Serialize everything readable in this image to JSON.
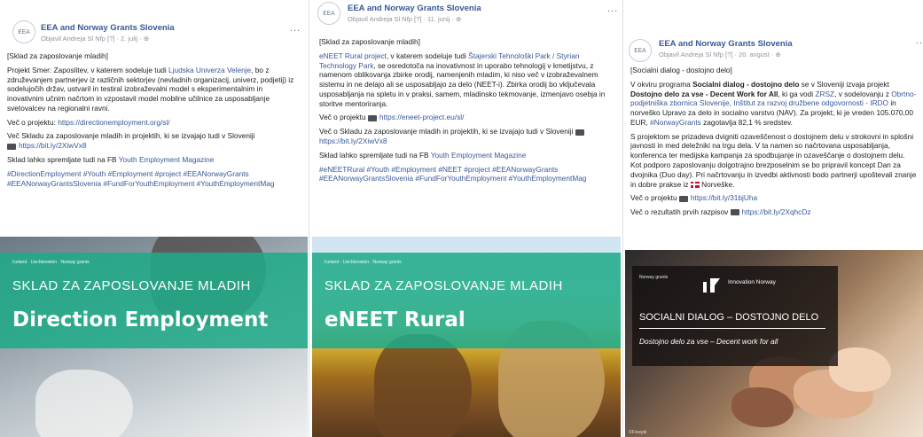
{
  "posts": [
    {
      "page_name": "EEA and Norway Grants Slovenia",
      "meta": "Objavil Andreja Sl Nfp [?] · 2. julij · ",
      "more": "...",
      "paragraphs": {
        "title": "[Sklad za zaposlovanje mladih]",
        "p1_a": "Projekt Smer: Zaposlitev, v katerem sodeluje tudi ",
        "p1_link": "Ljudska Univerza Velenje",
        "p1_b": ", bo z združevanjem partnerjev iz različnih sektorjev (nevladnih organizacij, univerz, podjetij) iz sodelujočih držav, ustvaril in testiral izobraževalni model s eksperimentalnim in inovativnim učnim načrtom in vzpostavil model mobilne učilnice za usposabljanje svetovalcev na regionalni ravni.",
        "p2_a": "Več o projektu: ",
        "p2_link": "https://directionemployment.org/sl/",
        "p3": "Več Skladu za zaposlovanje mladih in projektih, ki se izvajajo tudi v Sloveniji",
        "p3_link": "https://bit.ly/2XiwVx8",
        "p4_a": "Sklad lahko spremljate tudi na FB ",
        "p4_link": "Youth Employment Magazine",
        "tags": "#DirectionEmployment #Youth #Employment #project #EEANorwayGrants #EEANorwayGrantsSlovenia #FundForYouthEmployment #YouthEmploymentMag"
      },
      "image": {
        "logo_text": "Iceland · Liechtenstein · Norway grants",
        "band_title": "SKLAD ZA ZAPOSLOVANJE MLADIH",
        "project_name": "Direction Employment"
      }
    },
    {
      "page_name": "EEA and Norway Grants Slovenia",
      "meta": "Objavil Andreja Sl Nfp [?] · 11. junij · ",
      "more": "...",
      "paragraphs": {
        "title": "[Sklad za zaposlovanje mladih]",
        "p1_link_a": "eNEET Rural project",
        "p1_a": ", v katerem sodeluje tudi ",
        "p1_link_b": "Štajerski Tehnološki Park / Styrian Technology Park",
        "p1_b": ", se osredotoča na inovativnost in uporabo tehnologij v kmetijstvu, z namenom oblikovanja zbirke orodij, namenjenih mladim, ki niso več v izobraževalnem sistemu in ne delajo ali se usposabljajo za delo (NEET-i). Zbirka orodij bo vključevala usposabljanja na spletu in v praksi, samem, mladinsko tekmovanje, izmenjavo osebja in storitve mentoriranja.",
        "p2_a": "Več o projektu",
        "p2_link": "https://eneet-project.eu/sl/",
        "p3": "Več o Skladu za zaposlovanje mladih in projektih, ki se izvajajo tudi v Sloveniji",
        "p3_link": "https://bit.ly/2XiwVx8",
        "p4_a": "Sklad lahko spremljate tudi na FB ",
        "p4_link": "Youth Employment Magazine",
        "tags": "#eNEETRural #Youth #Employment #NEET #project #EEANorwayGrants #EEANorwayGrantsSlovenia #FundForYouthEmployment #YouthEmploymentMag"
      },
      "image": {
        "logo_text": "Iceland · Liechtenstein · Norway grants",
        "band_title": "SKLAD ZA ZAPOSLOVANJE MLADIH",
        "project_name": "eNEET Rural"
      }
    },
    {
      "page_name": "EEA and Norway Grants Slovenia",
      "meta": "Objavil Andreja Sl Nfp [?] · 20. avgust · ",
      "more": "...",
      "paragraphs": {
        "title": "[Socialni dialog - dostojno delo]",
        "p1_a": "V okviru programa ",
        "p1_bold": "Socialni dialog - dostojno delo",
        "p1_b": " se v Sloveniji izvaja projekt ",
        "p1_bold2": "Dostojno delo za vse - Decent Work for All",
        "p1_c": ", ki ga vodi ",
        "p1_link": "ZRSZ",
        "p1_d": ", v sodelovanju z ",
        "p1_link2": "Obrtno-podjetniška zbornica Slovenije, Inštitut za razvoj družbene odgovornosti - IRDO",
        "p1_e": " in norveško Upravo za delo in socialno varstvo (NAV). Za projekt, ki je vreden 105.070,00 EUR, ",
        "p1_tag": "#NorwayGrants",
        "p1_f": " zagotavlja 82,1 % sredstev.",
        "p2": "S projektom se prizadeva dvigniti ozaveščenost o dostojnem delu v strokovni in splošni javnosti in med deležniki na trgu dela. V ta namen so načrtovana usposabljanja, konferenca ter medijska kampanja za spodbujanje in ozaveščanje o dostojnem delu. Kot podporo zaposlovanju dolgotrajno brezposelnim se bo pripravil koncept Dan za dvojnika (Duo day). Pri načrtovanju in izvedbi aktivnosti bodo partnerji upoštevali znanje in dobre prakse iz ",
        "p2_end": " Norveške.",
        "p3_a": "Več o projektu",
        "p3_link": "https://bit.ly/31bjUha",
        "p4_a": "Več o rezultatih prvih razpisov",
        "p4_link": "https://bit.ly/2XqhcDz"
      },
      "image": {
        "logo_text": "Norway grants",
        "innov_text": "Innovation Norway",
        "band_title": "SOCIALNI DIALOG – DOSTOJNO DELO",
        "subtitle": "Dostojno delo za vse – Decent work for all",
        "credit": "©Freepik"
      }
    }
  ],
  "colors": {
    "link": "#385898",
    "band_green": "#1eaa87"
  },
  "icons": {
    "globe": "globe-icon",
    "link": "link-icon",
    "flag": "norway-flag-icon",
    "more": "more-icon"
  }
}
